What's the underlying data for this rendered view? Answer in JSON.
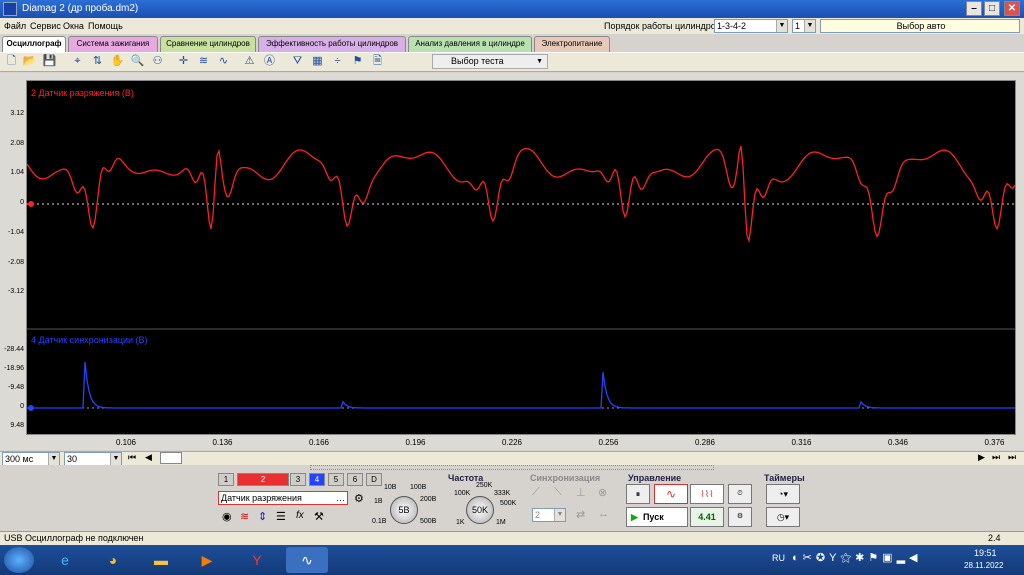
{
  "window": {
    "title": "Diamag 2 (др проба.dm2)"
  },
  "menu": [
    "Файл",
    "Сервис",
    "Окна",
    "Помощь"
  ],
  "header": {
    "cyl_order_label": "Порядок работы цилиндров",
    "cyl_order_value": "1-3-4-2",
    "cyl_num": "1",
    "auto_select": "Выбор авто"
  },
  "tabs": [
    {
      "label": "Осциллограф",
      "color": "#ffffff"
    },
    {
      "label": "Система зажигания",
      "color": "#e8a8e0"
    },
    {
      "label": "Сравнение цилиндров",
      "color": "#c8e0a0"
    },
    {
      "label": "Эффективность работы цилиндров",
      "color": "#d8b0e8"
    },
    {
      "label": "Анализ давления в цилиндре",
      "color": "#b8e0b0"
    },
    {
      "label": "Электропитание",
      "color": "#e8c8b8"
    }
  ],
  "toolbar": {
    "select_test": "Выбор теста"
  },
  "scope": {
    "ch2_label": "2 Датчик разряжения (В)",
    "ch4_label": "4 Датчик синхронизации (В)",
    "ch2_ticks": [
      "3.12",
      "2.08",
      "1.04",
      "0",
      "-1.04",
      "-2.08",
      "-3.12"
    ],
    "ch4_ticks": [
      "-28.44",
      "-18.96",
      "-9.48",
      "0",
      "9.48"
    ],
    "x_ticks": [
      "0.106",
      "0.136",
      "0.166",
      "0.196",
      "0.226",
      "0.256",
      "0.286",
      "0.316",
      "0.346",
      "0.376"
    ],
    "ch2_color": "#ff2020",
    "ch4_color": "#2244ff"
  },
  "scroll": {
    "timebase": "300 мс",
    "count": "30"
  },
  "bottom": {
    "channels": [
      "1",
      "2",
      "3",
      "4",
      "5",
      "6",
      "D"
    ],
    "sensor": "Датчик разряжения",
    "volt_labels": [
      "10В",
      "100В",
      "1В",
      "200В",
      "0.1В",
      "500В"
    ],
    "volt_value": "5В",
    "freq_title": "Частота",
    "freq_labels": [
      "250K",
      "100K",
      "333K",
      "500K",
      "1K",
      "1M"
    ],
    "freq_value": "50K",
    "sync_title": "Синхронизация",
    "sync_value": "2",
    "ctrl_title": "Управление",
    "start_label": "Пуск",
    "ctrl_value": "4.41",
    "timers_title": "Таймеры"
  },
  "status": {
    "text": "USB Осциллограф не подключен",
    "right": "2.4"
  },
  "taskbar": {
    "lang": "RU",
    "time": "19:51",
    "date": "28.11.2022"
  }
}
